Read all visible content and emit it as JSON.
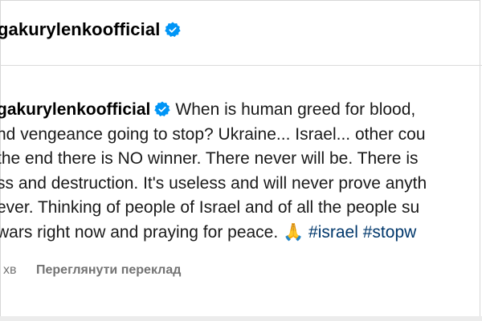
{
  "header": {
    "username": "gakurylenkoofficial",
    "verified_icon": "verified-badge-icon"
  },
  "post": {
    "username": "gakurylenkoofficial",
    "lines": [
      "When is human greed for blood,",
      "nd vengeance going to stop? Ukraine... Israel... other cou",
      " the end there is NO winner. There never will be. There is",
      "ss and destruction. It's useless and will never prove anyth",
      "ever. Thinking of people of Israel and of all the people su",
      " wars right now and praying for peace. "
    ],
    "emoji": "🙏",
    "hashtags": [
      "#israel",
      "#stopw"
    ]
  },
  "meta": {
    "time": "хв",
    "see_translation": "Переглянути переклад"
  },
  "colors": {
    "verified": "#0095f6",
    "hashtag": "#00376b",
    "meta_text": "#737373"
  }
}
